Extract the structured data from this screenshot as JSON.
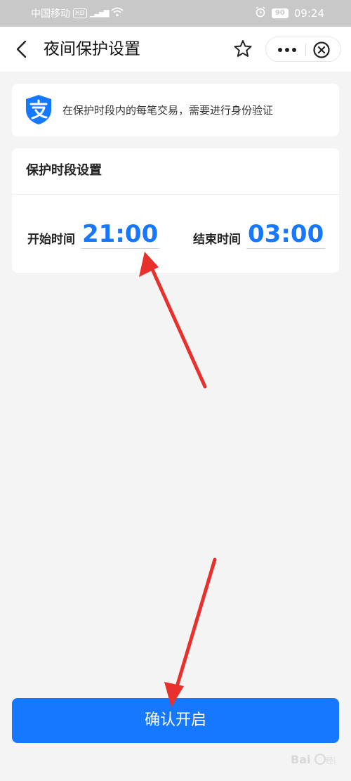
{
  "status_bar": {
    "carrier": "中国移动",
    "hd": "HD",
    "signal_tag": "⁴ᴳ",
    "battery": "90",
    "time": "09:24"
  },
  "nav": {
    "title": "夜间保护设置",
    "icons": [
      "chevron-left-icon",
      "star-icon",
      "more-dots-icon",
      "close-circle-icon"
    ]
  },
  "info": {
    "text": "在保护时段内的每笔交易，需要进行身份验证",
    "icon": "alipay-shield-icon"
  },
  "protection": {
    "title": "保护时段设置",
    "start_label": "开始时间",
    "start_value": "21:00",
    "end_label": "结束时间",
    "end_value": "03:00"
  },
  "confirm_label": "确认开启",
  "colors": {
    "accent": "#1677ff",
    "annotation_arrow": "#e8302c",
    "page_bg": "#f4f4f4"
  }
}
